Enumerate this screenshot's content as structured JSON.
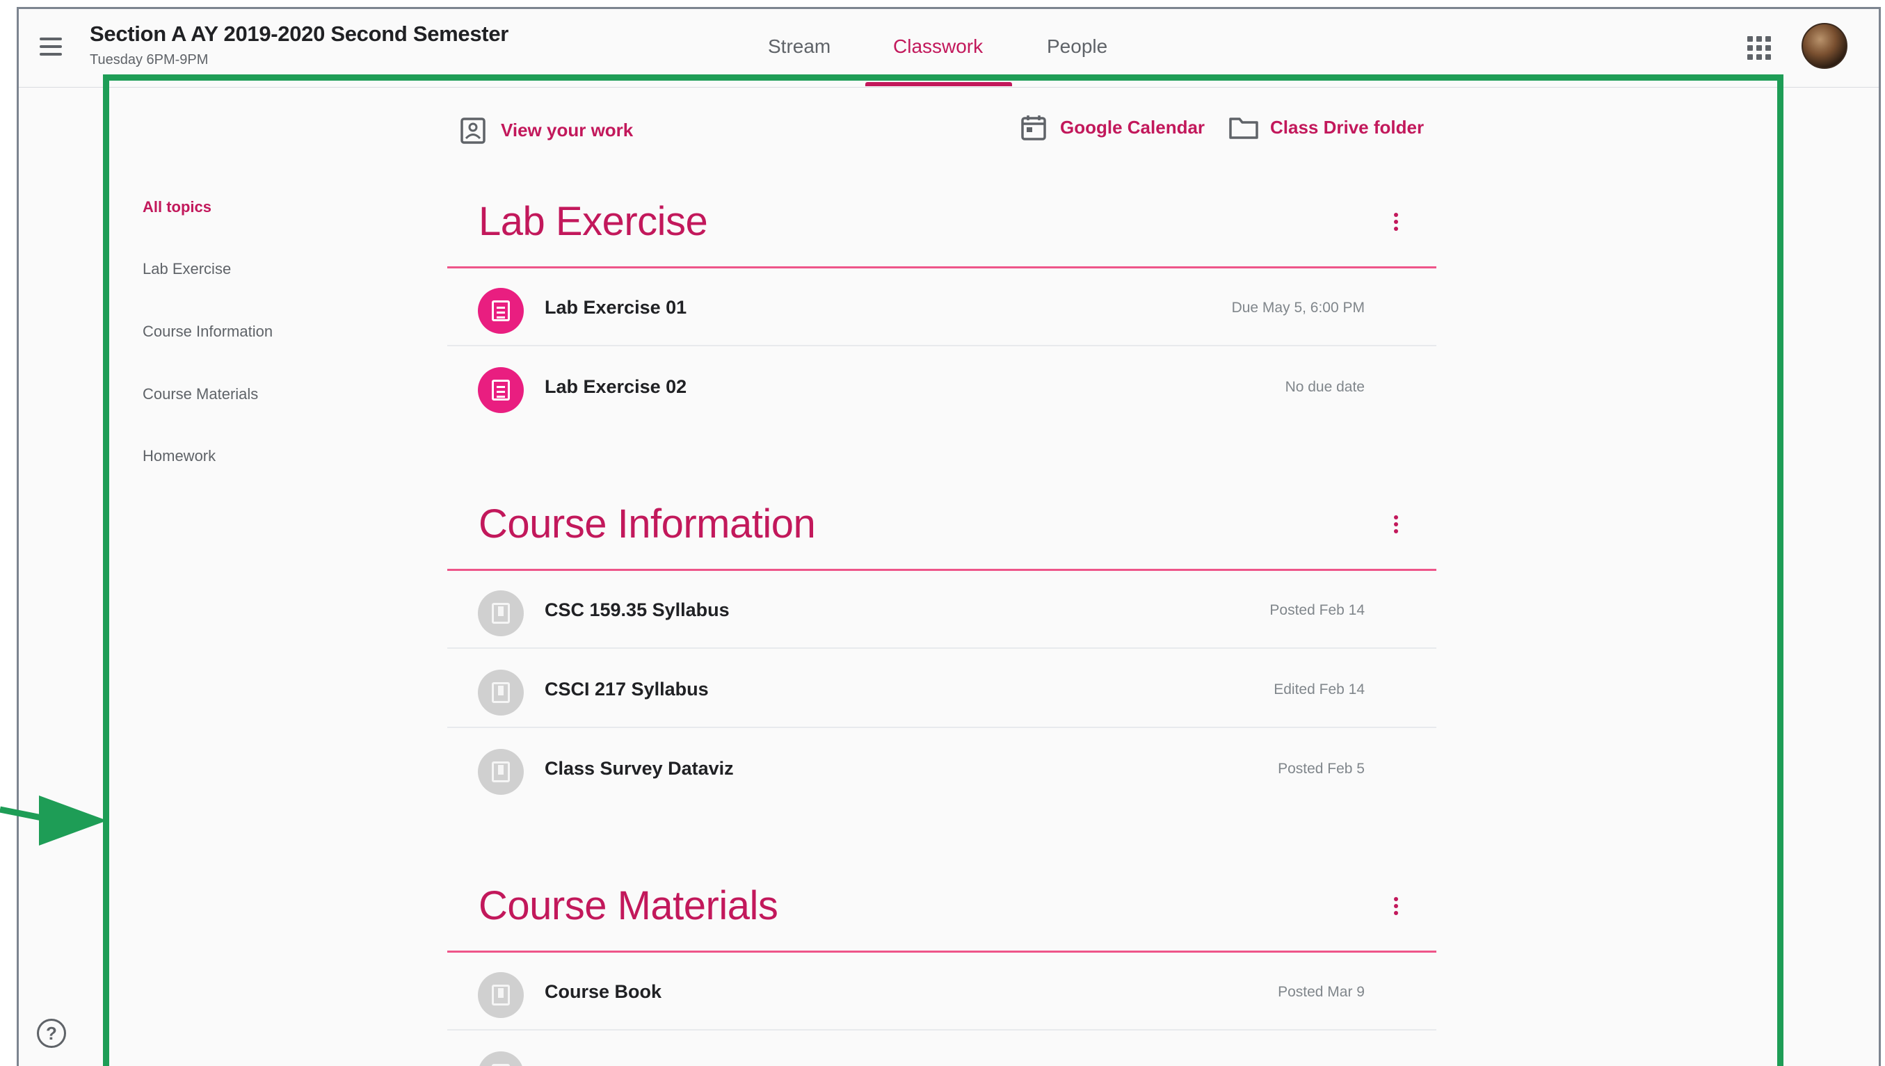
{
  "header": {
    "class_title": "Section A AY 2019-2020 Second Semester",
    "class_schedule": "Tuesday 6PM-9PM",
    "tabs": [
      {
        "label": "Stream"
      },
      {
        "label": "Classwork"
      },
      {
        "label": "People"
      }
    ],
    "active_tab": "Classwork"
  },
  "toolbar": {
    "view_work": "View your work",
    "google_calendar": "Google Calendar",
    "class_drive": "Class Drive folder"
  },
  "sidenav": {
    "items": [
      {
        "label": "All topics"
      },
      {
        "label": "Lab Exercise"
      },
      {
        "label": "Course Information"
      },
      {
        "label": "Course Materials"
      },
      {
        "label": "Homework"
      }
    ]
  },
  "sections": [
    {
      "title": "Lab Exercise",
      "items": [
        {
          "title": "Lab Exercise 01",
          "meta": "Due May 5, 6:00 PM",
          "icon": "assignment-icon"
        },
        {
          "title": "Lab Exercise 02",
          "meta": "No due date",
          "icon": "assignment-icon"
        }
      ]
    },
    {
      "title": "Course Information",
      "items": [
        {
          "title": "CSC 159.35 Syllabus",
          "meta": "Posted Feb 14",
          "icon": "material-icon"
        },
        {
          "title": "CSCI 217 Syllabus",
          "meta": "Edited Feb 14",
          "icon": "material-icon"
        },
        {
          "title": "Class Survey Dataviz",
          "meta": "Posted Feb 5",
          "icon": "material-icon"
        }
      ]
    },
    {
      "title": "Course Materials",
      "items": [
        {
          "title": "Course Book",
          "meta": "Posted Mar 9",
          "icon": "material-icon"
        }
      ]
    }
  ],
  "colors": {
    "accent": "#c2185b",
    "assignment_icon": "#e91e80",
    "highlight_box": "#1e9d56"
  }
}
